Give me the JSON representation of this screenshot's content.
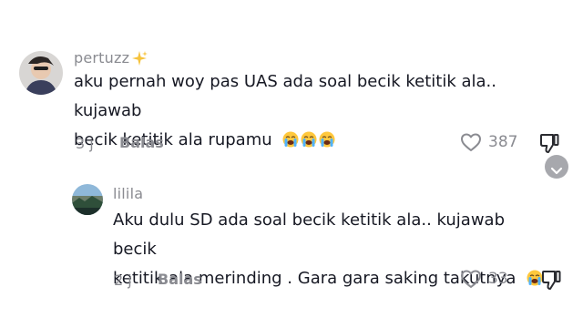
{
  "comments": [
    {
      "username": "pertuzz",
      "username_badge": "sparkles-emoji",
      "text_line1": "aku pernah woy pas UAS ada soal becik ketitik ala.. kujawab",
      "text_line2": "becik ketitik ala rupamu",
      "emoji": "loudly-crying-face",
      "emoji_count": 3,
      "time": "3 j",
      "reply_label": "Balas",
      "like_count": "387"
    },
    {
      "username": "lilila",
      "text_line1": "Aku dulu SD ada soal becik ketitik ala.. kujawab becik",
      "text_line2": "ketitik ala merinding . Gara gara saking takutnya",
      "emoji": "loudly-crying-face",
      "emoji_count": 1,
      "time": "2 j",
      "reply_label": "Balas",
      "like_count": "33"
    }
  ],
  "colors": {
    "text": "#161823",
    "secondary": "#8a8b91",
    "expand_button": "#a7a8ad"
  }
}
